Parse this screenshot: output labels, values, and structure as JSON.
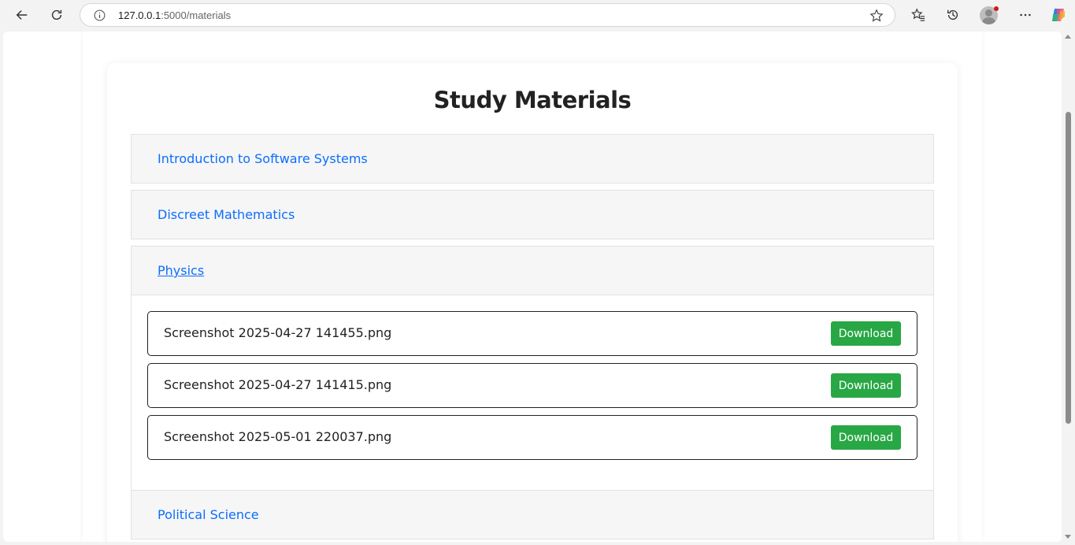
{
  "browser": {
    "url_host": "127.0.0.1",
    "url_path": ":5000/materials",
    "icons": [
      "back-icon",
      "reload-icon",
      "info-icon",
      "star-icon",
      "favorites-icon",
      "history-icon",
      "profile-icon",
      "more-icon",
      "copilot-icon"
    ]
  },
  "page": {
    "title": "Study Materials",
    "subjects": [
      {
        "label": "Introduction to Software Systems",
        "expanded": false
      },
      {
        "label": "Discreet Mathematics",
        "expanded": false
      },
      {
        "label": "Physics",
        "expanded": true
      },
      {
        "label": "Political Science",
        "expanded": false
      }
    ],
    "files": [
      {
        "name": "Screenshot 2025-04-27 141455.png",
        "action": "Download"
      },
      {
        "name": "Screenshot 2025-04-27 141415.png",
        "action": "Download"
      },
      {
        "name": "Screenshot 2025-05-01 220037.png",
        "action": "Download"
      }
    ],
    "colors": {
      "link": "#0d6efd",
      "download_button": "#28a745"
    }
  }
}
